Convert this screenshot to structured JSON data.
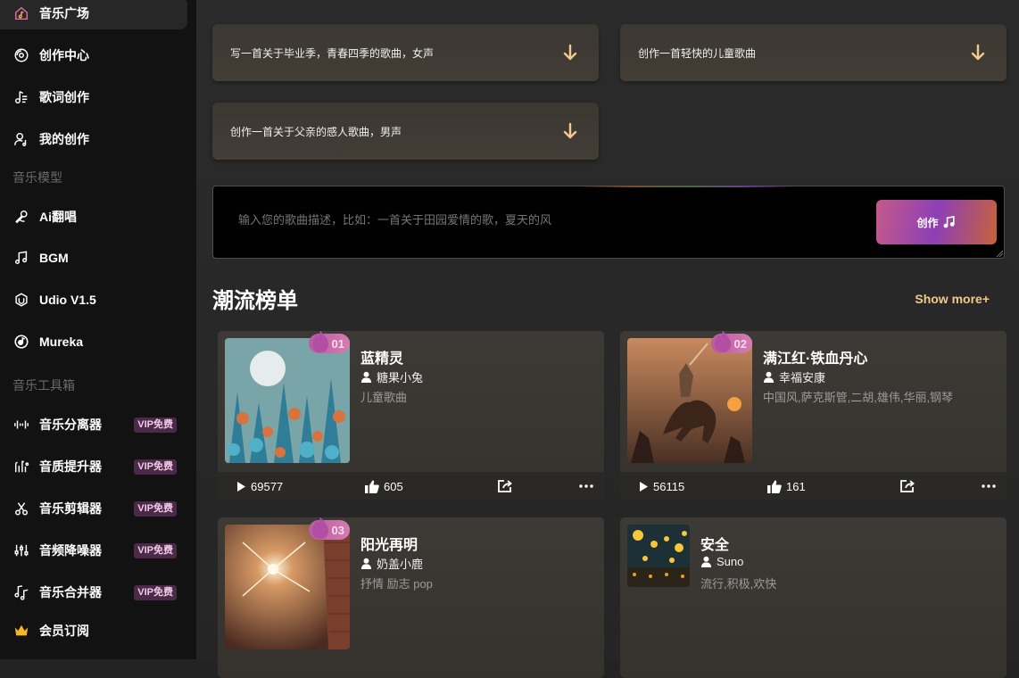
{
  "sidebar": {
    "items": [
      {
        "label": "音乐广场",
        "icon": "home-music-icon"
      },
      {
        "label": "创作中心",
        "icon": "disc-icon"
      },
      {
        "label": "歌词创作",
        "icon": "lyrics-icon"
      },
      {
        "label": "我的创作",
        "icon": "user-music-icon"
      }
    ],
    "models_title": "音乐模型",
    "models": [
      {
        "label": "Ai翻唱",
        "icon": "microphone-icon"
      },
      {
        "label": "BGM",
        "icon": "music-note-icon"
      },
      {
        "label": "Udio V1.5",
        "icon": "udio-icon"
      },
      {
        "label": "Mureka",
        "icon": "mureka-icon"
      }
    ],
    "tools_title": "音乐工具箱",
    "tools": [
      {
        "label": "音乐分离器",
        "badge": "VIP免费",
        "icon": "waveform-icon"
      },
      {
        "label": "音质提升器",
        "badge": "VIP免费",
        "icon": "quality-icon"
      },
      {
        "label": "音乐剪辑器",
        "badge": "VIP免费",
        "icon": "scissors-icon"
      },
      {
        "label": "音频降噪器",
        "badge": "VIP免费",
        "icon": "equalizer-icon"
      },
      {
        "label": "音乐合并器",
        "badge": "VIP免费",
        "icon": "merge-icon"
      }
    ],
    "vip": {
      "label": "会员订阅",
      "icon": "crown-icon"
    }
  },
  "suggestions": [
    "写一首关于毕业季，青春四季的歌曲，女声",
    "创作一首轻快的儿童歌曲",
    "创作一首关于父亲的感人歌曲，男声"
  ],
  "prompt": {
    "placeholder": "输入您的歌曲描述，比如：一首关于田园爱情的歌，夏天的风",
    "button_label": "创作"
  },
  "ranking": {
    "title": "潮流榜单",
    "show_more": "Show more+",
    "songs": [
      {
        "rank": "01",
        "title": "蓝精灵",
        "author": "糖果小兔",
        "tags": "儿童歌曲",
        "plays": "69577",
        "likes": "605"
      },
      {
        "rank": "02",
        "title": "满江红·铁血丹心",
        "author": "幸福安康",
        "tags": "中国风,萨克斯管,二胡,雄伟,华丽,钢琴",
        "plays": "56115",
        "likes": "161"
      },
      {
        "rank": "03",
        "title": "阳光再明",
        "author": "奶盖小鹿",
        "tags": "抒情 励志 pop"
      },
      {
        "rank": "",
        "title": "安全",
        "author": "Suno",
        "tags": "流行,积极,欢快"
      }
    ]
  },
  "colors": {
    "accent": "#f2c98a",
    "vip_text": "#f0c9e6",
    "badge": "#c86aa8"
  }
}
